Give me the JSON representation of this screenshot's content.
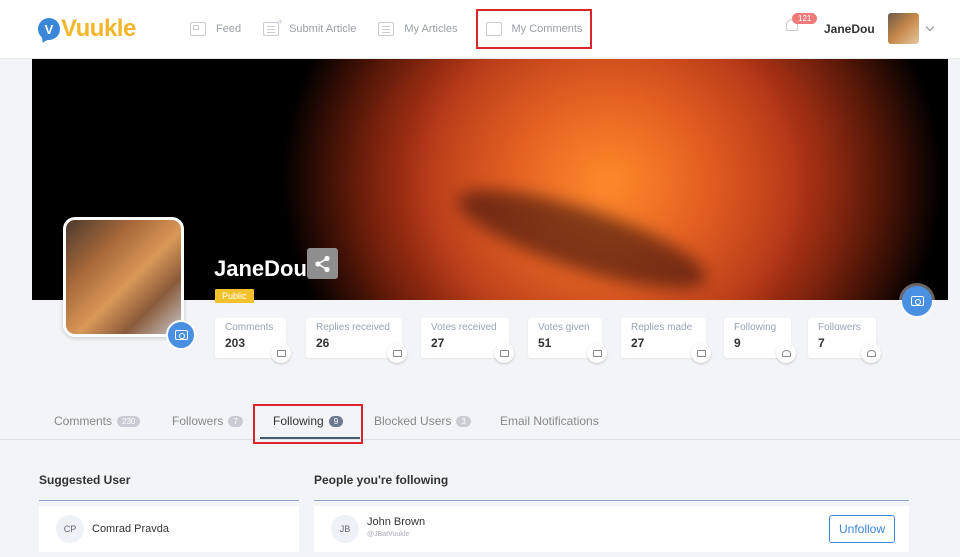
{
  "header": {
    "logo_letter": "V",
    "logo_text": "Vuukle",
    "nav": [
      {
        "label": "Feed",
        "icon": "grid-icon"
      },
      {
        "label": "Submit Article",
        "icon": "add-article-icon"
      },
      {
        "label": "My Articles",
        "icon": "articles-icon"
      },
      {
        "label": "My Comments",
        "icon": "comment-bubble-icon"
      }
    ],
    "notification_count": "121",
    "username": "JaneDou"
  },
  "profile": {
    "name": "JaneDou",
    "visibility": "Public"
  },
  "stats": [
    {
      "label": "Comments",
      "value": "203"
    },
    {
      "label": "Replies received",
      "value": "26"
    },
    {
      "label": "Votes received",
      "value": "27"
    },
    {
      "label": "Votes given",
      "value": "51"
    },
    {
      "label": "Replies made",
      "value": "27"
    },
    {
      "label": "Following",
      "value": "9"
    },
    {
      "label": "Followers",
      "value": "7"
    }
  ],
  "tabs": [
    {
      "label": "Comments",
      "count": "230"
    },
    {
      "label": "Followers",
      "count": "7"
    },
    {
      "label": "Following",
      "count": "9"
    },
    {
      "label": "Blocked Users",
      "count": "3"
    },
    {
      "label": "Email Notifications",
      "count": ""
    }
  ],
  "suggested": {
    "title": "Suggested User",
    "users": [
      {
        "initials": "CP",
        "name": "Comrad Pravda"
      }
    ]
  },
  "following": {
    "title": "People you're following",
    "users": [
      {
        "initials": "JB",
        "name": "John Brown",
        "handle": "@JBatVuukle",
        "action": "Unfollow"
      }
    ]
  },
  "colors": {
    "accent": "#3a86d8",
    "brand_yellow": "#f3b62b",
    "highlight": "#d9262b"
  }
}
